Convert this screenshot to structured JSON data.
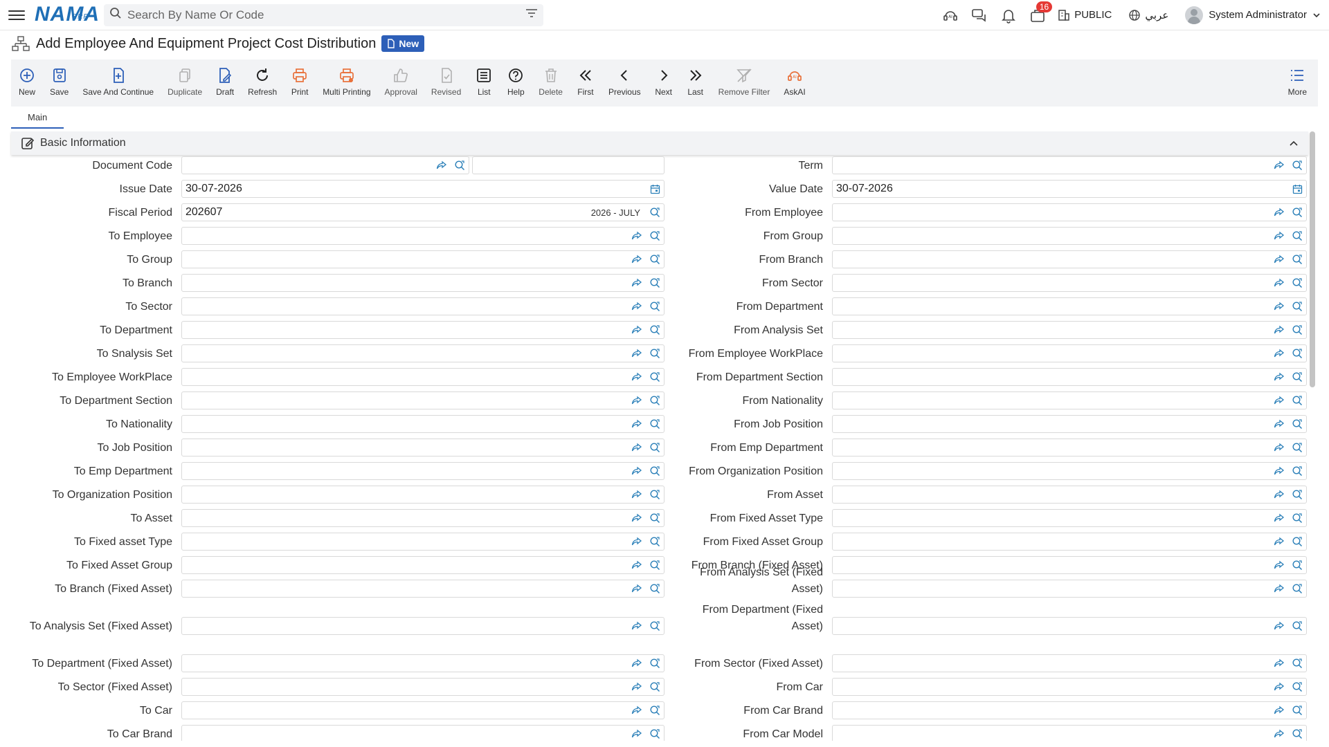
{
  "topbar": {
    "logo_text": "NAMA",
    "logo_sub": "ERP",
    "search_placeholder": "Search By Name Or Code",
    "notification_count": "16",
    "public_label": "PUBLIC",
    "language_label": "عربي",
    "user_name": "System Administrator"
  },
  "page": {
    "title": "Add Employee And Equipment Project Cost Distribution",
    "status_badge": "New"
  },
  "toolbar": [
    {
      "name": "new",
      "label": "New",
      "icon": "plus-circle-icon",
      "color": "#2d5fb8"
    },
    {
      "name": "save",
      "label": "Save",
      "icon": "save-icon",
      "color": "#2d5fb8"
    },
    {
      "name": "save-and-continue",
      "label": "Save And Continue",
      "icon": "save-continue-icon",
      "color": "#2d5fb8"
    },
    {
      "name": "duplicate",
      "label": "Duplicate",
      "icon": "duplicate-icon",
      "color": "#b0b0b0"
    },
    {
      "name": "draft",
      "label": "Draft",
      "icon": "draft-icon",
      "color": "#2d5fb8"
    },
    {
      "name": "refresh",
      "label": "Refresh",
      "icon": "refresh-icon",
      "color": "#222"
    },
    {
      "name": "print",
      "label": "Print",
      "icon": "print-icon",
      "color": "#e8703a"
    },
    {
      "name": "multi-printing",
      "label": "Multi Printing",
      "icon": "multi-print-icon",
      "color": "#e8703a"
    },
    {
      "name": "approval",
      "label": "Approval",
      "icon": "thumbs-up-icon",
      "color": "#b0b0b0"
    },
    {
      "name": "revised",
      "label": "Revised",
      "icon": "revised-icon",
      "color": "#b0b0b0"
    },
    {
      "name": "list",
      "label": "List",
      "icon": "list-icon",
      "color": "#222"
    },
    {
      "name": "help",
      "label": "Help",
      "icon": "help-icon",
      "color": "#222"
    },
    {
      "name": "delete",
      "label": "Delete",
      "icon": "trash-icon",
      "color": "#b0b0b0"
    },
    {
      "name": "first",
      "label": "First",
      "icon": "double-chevron-left-icon",
      "color": "#222"
    },
    {
      "name": "previous",
      "label": "Previous",
      "icon": "chevron-left-icon",
      "color": "#222"
    },
    {
      "name": "next",
      "label": "Next",
      "icon": "chevron-right-icon",
      "color": "#222"
    },
    {
      "name": "last",
      "label": "Last",
      "icon": "double-chevron-right-icon",
      "color": "#222"
    },
    {
      "name": "remove-filter",
      "label": "Remove Filter",
      "icon": "remove-filter-icon",
      "color": "#b0b0b0"
    },
    {
      "name": "askai",
      "label": "AskAI",
      "icon": "ai-icon",
      "color": "#e8703a"
    }
  ],
  "toolbar_more_label": "More",
  "tabs": [
    {
      "label": "Main"
    }
  ],
  "section": {
    "title": "Basic Information"
  },
  "left_fields": [
    {
      "label": "Document Code",
      "value": ""
    },
    {
      "label": "Issue Date",
      "value": "30-07-2026"
    },
    {
      "label": "Fiscal Period",
      "value": "202607",
      "extra": "2026 - JULY"
    },
    {
      "label": "To Employee",
      "value": ""
    },
    {
      "label": "To Group",
      "value": ""
    },
    {
      "label": "To Branch",
      "value": ""
    },
    {
      "label": "To Sector",
      "value": ""
    },
    {
      "label": "To Department",
      "value": ""
    },
    {
      "label": "To Snalysis Set",
      "value": ""
    },
    {
      "label": "To Employee WorkPlace",
      "value": ""
    },
    {
      "label": "To Department Section",
      "value": ""
    },
    {
      "label": "To Nationality",
      "value": ""
    },
    {
      "label": "To Job Position",
      "value": ""
    },
    {
      "label": "To Emp Department",
      "value": ""
    },
    {
      "label": "To Organization Position",
      "value": ""
    },
    {
      "label": "To Asset",
      "value": ""
    },
    {
      "label": "To Fixed asset Type",
      "value": ""
    },
    {
      "label": "To Fixed Asset Group",
      "value": ""
    },
    {
      "label": "To Branch (Fixed Asset)",
      "value": ""
    },
    {
      "label": "To Analysis Set (Fixed Asset)",
      "value": ""
    },
    {
      "label": "To Department (Fixed Asset)",
      "value": ""
    },
    {
      "label": "To Sector (Fixed Asset)",
      "value": ""
    },
    {
      "label": "To Car",
      "value": ""
    },
    {
      "label": "To Car Brand",
      "value": ""
    }
  ],
  "right_fields": [
    {
      "label": "Term",
      "value": ""
    },
    {
      "label": "Value Date",
      "value": "30-07-2026"
    },
    {
      "label": "From Employee",
      "value": ""
    },
    {
      "label": "From Group",
      "value": ""
    },
    {
      "label": "From Branch",
      "value": ""
    },
    {
      "label": "From Sector",
      "value": ""
    },
    {
      "label": "From Department",
      "value": ""
    },
    {
      "label": "From Analysis Set",
      "value": ""
    },
    {
      "label": "From Employee WorkPlace",
      "value": ""
    },
    {
      "label": "From Department Section",
      "value": ""
    },
    {
      "label": "From Nationality",
      "value": ""
    },
    {
      "label": "From Job Position",
      "value": ""
    },
    {
      "label": "From Emp Department",
      "value": ""
    },
    {
      "label": "From Organization Position",
      "value": ""
    },
    {
      "label": "From Asset",
      "value": ""
    },
    {
      "label": "From Fixed Asset Type",
      "value": ""
    },
    {
      "label": "From Fixed Asset Group",
      "value": ""
    },
    {
      "label": "From Branch (Fixed Asset)",
      "value": ""
    },
    {
      "label": "From Analysis Set (Fixed Asset)",
      "value": ""
    },
    {
      "label": "From Department (Fixed Asset)",
      "value": ""
    },
    {
      "label": "From Sector (Fixed Asset)",
      "value": ""
    },
    {
      "label": "From Car",
      "value": ""
    },
    {
      "label": "From Car Brand",
      "value": ""
    },
    {
      "label": "From Car Model",
      "value": ""
    }
  ]
}
